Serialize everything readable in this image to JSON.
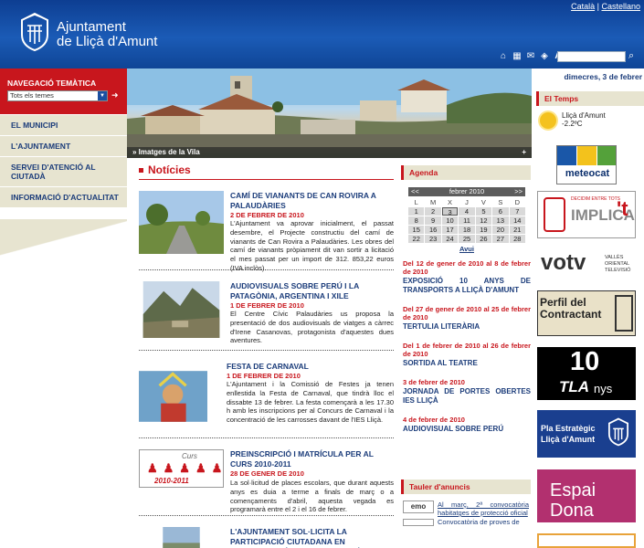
{
  "header": {
    "lang_ca": "Català",
    "lang_sep": "|",
    "lang_es": "Castellano",
    "title_line1": "Ajuntament",
    "title_line2": "de Lliçà d'Amunt"
  },
  "date": "dimecres, 3 de febrer",
  "nav": {
    "title": "NAVEGACIÓ TEMÀTICA",
    "select_value": "Tots els temes",
    "items": [
      "EL MUNICIPI",
      "L'AJUNTAMENT",
      "SERVEI D'ATENCIÓ AL CIUTADÀ",
      "INFORMACIÓ D'ACTUALITAT"
    ]
  },
  "hero": {
    "caption": "» Imatges de la Vila",
    "more": "+"
  },
  "news": {
    "title": "Notícies",
    "items": [
      {
        "title": "CAMÍ DE VIANANTS DE CAN ROVIRA A PALAUDÀRIES",
        "date": "2 de febrer de 2010",
        "text": "L'Ajuntament va aprovar inicialment, el passat desembre, el Projecte constructiu del camí de vianants de Can Rovira a Palaudàries. Les obres del camí de vianants pròpiament dit van sortir a licitació el mes passat per un import de 312. 853,22 euros (IVA inclòs)."
      },
      {
        "title": "AUDIOVISUALS SOBRE PERÚ I LA PATAGÒNIA, ARGENTINA I XILE",
        "date": "1 de febrer de 2010",
        "text": "El Centre Cívic Palaudàries us proposa la presentació de dos audiovisuals de viatges a càrrec d'Irene Casanovas, protagonista d'aquestes dues aventures."
      },
      {
        "title": "FESTA DE CARNAVAL",
        "date": "1 de febrer de 2010",
        "text": "L'Ajuntament i la Comissió de Festes ja tenen enllestida la Festa de Carnaval, que tindrà lloc el dissabte 13 de febrer. La festa començarà a les 17.30 h amb les inscripcions per al Concurs de Carnaval i la concentració de les carrosses davant de l'IES Lliçà."
      },
      {
        "title": "PREINSCRIPCIÓ I MATRÍCULA PER AL CURS 2010-2011",
        "date": "28 de gener de 2010",
        "text": "La sol·licitud de places escolars, que durant aquests anys es duia a terme a finals de març o a començaments d'abril, aquesta vegada es programarà entre el 2 i el 16 de febrer."
      },
      {
        "title": "L'AJUNTAMENT SOL·LICITA LA PARTICIPACIÓ CIUTADANA EN L'ELABORACIÓ DEL PLA ESTRATÈGIC DE",
        "date": "",
        "text": ""
      }
    ],
    "thumb4_label": "Curs",
    "thumb4_years": "2010-2011"
  },
  "agenda": {
    "title": "Agenda",
    "month": "febrer 2010",
    "prev": "<<",
    "next": ">>",
    "weekdays": [
      "L",
      "M",
      "X",
      "J",
      "V",
      "S",
      "D"
    ],
    "days": [
      "1",
      "2",
      "3",
      "4",
      "5",
      "6",
      "7",
      "8",
      "9",
      "10",
      "11",
      "12",
      "13",
      "14",
      "15",
      "16",
      "17",
      "18",
      "19",
      "20",
      "21",
      "22",
      "23",
      "24",
      "25",
      "26",
      "27",
      "28"
    ],
    "today_label": "Avui",
    "events": [
      {
        "date": "Del 12 de gener de 2010 al 8 de febrer de 2010",
        "title": "EXPOSICIÓ 10 ANYS DE TRANSPORTS A LLIÇÀ D'AMUNT"
      },
      {
        "date": "Del 27 de gener de 2010 al 25 de febrer de 2010",
        "title": "TERTULIA LITERÀRIA"
      },
      {
        "date": "Del 1 de febrer de 2010 al 26 de febrer de 2010",
        "title": "SORTIDA AL TEATRE"
      },
      {
        "date": "3 de febrer de 2010",
        "title": "JORNADA DE PORTES OBERTES IES LLIÇÀ"
      },
      {
        "date": "4 de febrer de 2010",
        "title": "AUDIOVISUAL SOBRE PERÚ"
      }
    ]
  },
  "tauler": {
    "title": "Tauler d'anuncis",
    "badge": "emo",
    "item": "Al març, 2ª convocatòria habitatges de protecció oficial",
    "item2": "Convocatòria de proves de"
  },
  "weather": {
    "title": "El Temps",
    "town": "Lliçà d'Amunt",
    "temp": "-2.2ºC"
  },
  "banners": {
    "meteocat": "meteocat",
    "implica_small": "DECIDIM ENTRE TOTS",
    "implica": "IMPLICA",
    "implica_t": "'t",
    "votv": "votv",
    "votv_sub": "VALLÈS ORIENTAL TELEVISIÓ",
    "perfil": "Perfil del Contractant",
    "tla_num": "10",
    "tla": "TLA",
    "tla_anys": "nys",
    "pla": "Pla Estratègic Lliçà d'Amunt",
    "espai1": "Espai",
    "espai2": "Dona"
  },
  "colors": {
    "accent": "#c8161d",
    "navy": "#1b3c7a",
    "header": "#1b5bb6",
    "beige": "#e7e4d0"
  }
}
